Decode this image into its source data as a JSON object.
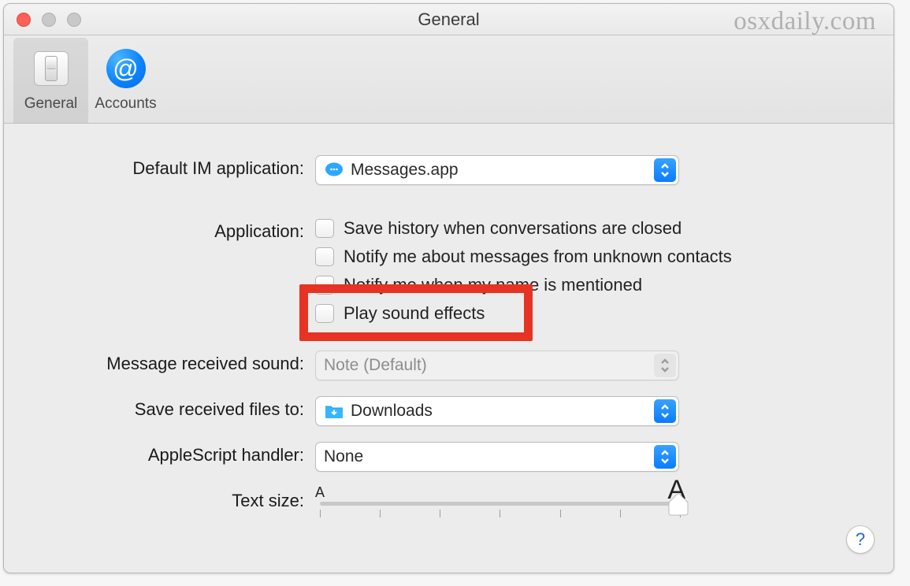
{
  "window": {
    "title": "General",
    "watermark": "osxdaily.com"
  },
  "toolbar": {
    "general": "General",
    "accounts": "Accounts"
  },
  "labels": {
    "default_im": "Default IM application:",
    "application": "Application:",
    "received_sound": "Message received sound:",
    "save_files": "Save received files to:",
    "applescript": "AppleScript handler:",
    "text_size": "Text size:"
  },
  "default_im": {
    "value": "Messages.app"
  },
  "application_checks": {
    "save_history": "Save history when conversations are closed",
    "notify_unknown": "Notify me about messages from unknown contacts",
    "notify_name": "Notify me when my name is mentioned",
    "sound_effects": "Play sound effects"
  },
  "received_sound": {
    "value": "Note (Default)"
  },
  "save_files": {
    "value": "Downloads"
  },
  "applescript": {
    "value": "None"
  },
  "text_size": {
    "small": "A",
    "big": "A"
  },
  "help": "?"
}
